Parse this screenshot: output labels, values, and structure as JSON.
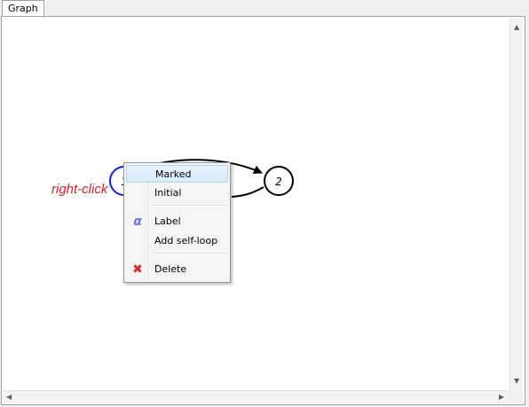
{
  "tab": {
    "label": "Graph"
  },
  "graph": {
    "nodes": [
      {
        "id": "1",
        "label": "1",
        "state": "selected"
      },
      {
        "id": "2",
        "label": "2",
        "state": "normal"
      }
    ],
    "edges": [
      {
        "from": "1",
        "to": "2"
      },
      {
        "from": "2",
        "to": "1"
      }
    ]
  },
  "annotation": {
    "text": "right-click",
    "color": "#d0202a"
  },
  "context_menu": {
    "items": [
      {
        "label": "Marked",
        "icon": "",
        "highlighted": true
      },
      {
        "label": "Initial",
        "icon": ""
      },
      {
        "label": "Label",
        "icon": "alpha-icon"
      },
      {
        "label": "Add self-loop",
        "icon": ""
      },
      {
        "label": "Delete",
        "icon": "delete-x-icon"
      }
    ]
  },
  "scrollbars": {
    "up_arrow": "▲",
    "down_arrow": "▼",
    "left_arrow": "◀",
    "right_arrow": "▶"
  },
  "colors": {
    "selected_node": "#1020d0",
    "node": "#000000",
    "menu_highlight": "#d6ebfa",
    "annotation": "#d0202a"
  }
}
